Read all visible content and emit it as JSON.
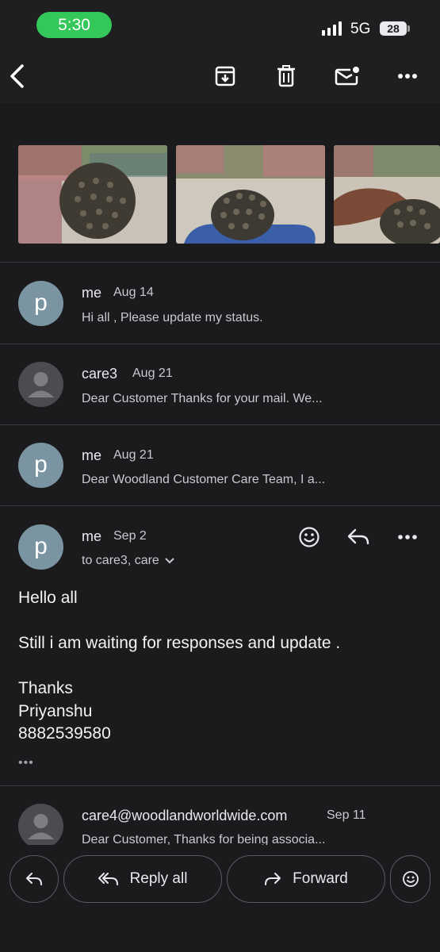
{
  "status_bar": {
    "time": "5:30",
    "network": "5G",
    "battery": "28"
  },
  "toolbar": {
    "back": "back-arrow-icon",
    "archive": "archive-icon",
    "delete": "trash-icon",
    "mark_unread": "mark-unread-icon",
    "more": "more-horizontal-icon"
  },
  "attachments": [
    "shoe-sole-photo-1",
    "shoe-sole-photo-2",
    "shoe-sole-photo-3"
  ],
  "messages": [
    {
      "avatar": "p",
      "sender": "me",
      "date": "Aug 14",
      "snippet": "Hi all , Please update my status."
    },
    {
      "avatar": "",
      "sender": "care3",
      "date": "Aug 21",
      "snippet": "Dear Customer Thanks for your mail. We..."
    },
    {
      "avatar": "p",
      "sender": "me",
      "date": "Aug 21",
      "snippet": "Dear Woodland Customer Care Team, I a..."
    }
  ],
  "expanded": {
    "avatar": "p",
    "sender": "me",
    "date": "Sep 2",
    "recipients": "to care3, care",
    "body": [
      "Hello all",
      "Still i am waiting for responses and update .",
      "Thanks",
      "Priyanshu",
      "8882539580"
    ],
    "ellipsis": "•••"
  },
  "last_message": {
    "sender": "care4@woodlandworldwide.com",
    "date": "Sep 11",
    "snippet": "Dear Customer, Thanks for being associa..."
  },
  "actions": {
    "reply_all": "Reply all",
    "forward": "Forward"
  },
  "colors": {
    "background": "#1b1b1d",
    "avatar_p": "#7b94a2",
    "status_green": "#34c759"
  }
}
